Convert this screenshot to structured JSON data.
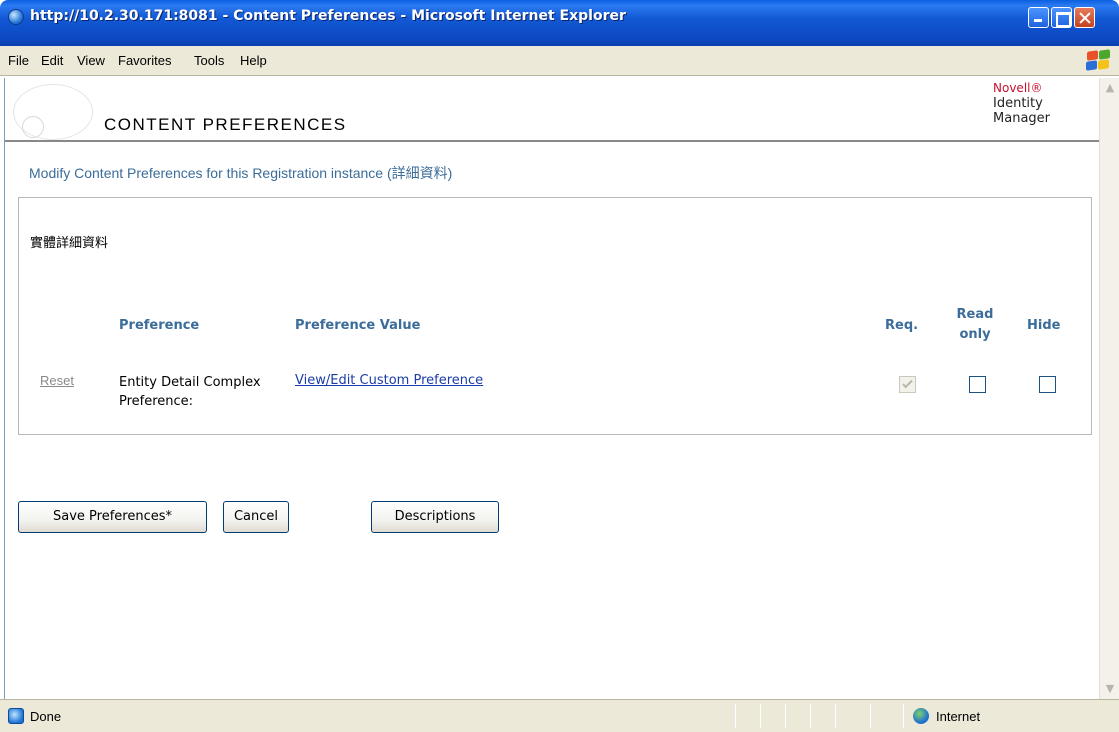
{
  "window": {
    "title": "http://10.2.30.171:8081 - Content Preferences - Microsoft Internet Explorer"
  },
  "menu": {
    "items": [
      "File",
      "Edit",
      "View",
      "Favorites",
      "Tools",
      "Help"
    ]
  },
  "header": {
    "page_title": "CONTENT PREFERENCES",
    "brand_novell": "Novell®",
    "brand_line1": "Identity",
    "brand_line2": "Manager"
  },
  "subtitle": "Modify Content Preferences for this Registration instance (詳細資料)",
  "panel": {
    "entity_title": "實體詳細資料",
    "columns": {
      "preference": "Preference",
      "preference_value": "Preference Value",
      "req": "Req.",
      "read_only_line1": "Read",
      "read_only_line2": "only",
      "hide": "Hide"
    },
    "row": {
      "reset_label": "Reset",
      "preference_label": "Entity Detail Complex Preference:",
      "value_link": "View/Edit Custom Preference",
      "req_checked": true,
      "read_only_checked": false,
      "hide_checked": false
    }
  },
  "buttons": {
    "save": "Save Preferences*",
    "cancel": "Cancel",
    "descriptions": "Descriptions"
  },
  "statusbar": {
    "status": "Done",
    "zone": "Internet"
  },
  "colors": {
    "link_blue": "#1a3ca6",
    "heading_blue": "#3b6c9a",
    "titlebar_blue": "#0c49c2",
    "novell_red": "#c8102e"
  }
}
